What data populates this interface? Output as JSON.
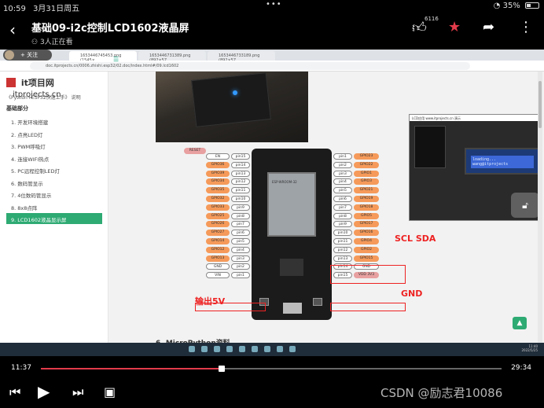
{
  "status_bar": {
    "time": "10:59",
    "date": "3月31日周五",
    "battery": "35%",
    "battery_level": 0.35
  },
  "video": {
    "title": "基础09-i2c控制LCD1602液晶屏",
    "viewers": "3人正在看",
    "like_count": "6116"
  },
  "browser": {
    "follow_label": "+ 关注",
    "tabs": [
      "1653446745453.png (1545×…",
      "1653446731389.png (892×57…",
      "1653446733189.png (892×57…"
    ],
    "url": "doc.itprojects.cn/0006.zhishi.esp32/02.doc/index.html#/09.lcd1602"
  },
  "site": {
    "logo": "it项目网",
    "domain": "itprojects.cn",
    "subtitle": "《Python+ESP32快速上手》 说明",
    "section": "基础部分",
    "nav": [
      "1. 开发环境搭建",
      "2. 点亮LED灯",
      "3. PWM呼吸灯",
      "4. 连接WIFI热点",
      "5. PC远程控制LED灯",
      "6. 数码管显示",
      "7. 4位数码管显示",
      "8. 8x8点阵",
      "9. LCD1602液晶显示屏"
    ],
    "active_index": 8,
    "next_heading": "6. MicroPython资料"
  },
  "pinout": {
    "board_name": "ESP-WROOM-32",
    "left_pins": [
      "pin15",
      "pin14",
      "pin13",
      "pin12",
      "pin11",
      "pin10",
      "pin9",
      "pin8",
      "pin7",
      "pin6",
      "pin5",
      "pin4",
      "pin3",
      "pin2",
      "pin1"
    ],
    "left_gpio": [
      "EN",
      "GPIO36",
      "GPIO39",
      "GPIO34",
      "GPIO35",
      "GPIO32",
      "GPIO33",
      "GPIO25",
      "GPIO26",
      "GPIO27",
      "GPIO14",
      "GPIO12",
      "GPIO13",
      "GND",
      "VIN"
    ],
    "right_pins": [
      "pin1",
      "pin2",
      "pin3",
      "pin4",
      "pin5",
      "pin6",
      "pin7",
      "pin8",
      "pin9",
      "pin10",
      "pin11",
      "pin12",
      "pin13",
      "pin14",
      "pin15"
    ],
    "right_gpio": [
      "GPIO23",
      "GPIO22",
      "GPIO1",
      "GPIO3",
      "GPIO21",
      "GPIO19",
      "GPIO18",
      "GPIO5",
      "GPIO17",
      "GPIO16",
      "GPIO4",
      "GPIO2",
      "GPIO15",
      "GND",
      "VDD 3V3"
    ],
    "reset_label": "RESET",
    "annotations": {
      "scl_sda": "SCL SDA",
      "gnd": "GND",
      "out5v": "输出5V"
    }
  },
  "lcd_video": {
    "window_title": "LCD应用 www.itprojects.cn 演示",
    "line1": "loading...",
    "line2": "wang@itprojects"
  },
  "taskbar": {
    "clock_time": "11:40",
    "clock_date": "2022/5/25"
  },
  "player": {
    "current_time": "11:37",
    "duration": "29:34",
    "progress": 0.393,
    "watermark": "CSDN @励志君10086"
  },
  "colors": {
    "accent_red": "#e33b4b",
    "nav_active": "#2eaa73",
    "annotation_red": "#e22222"
  }
}
